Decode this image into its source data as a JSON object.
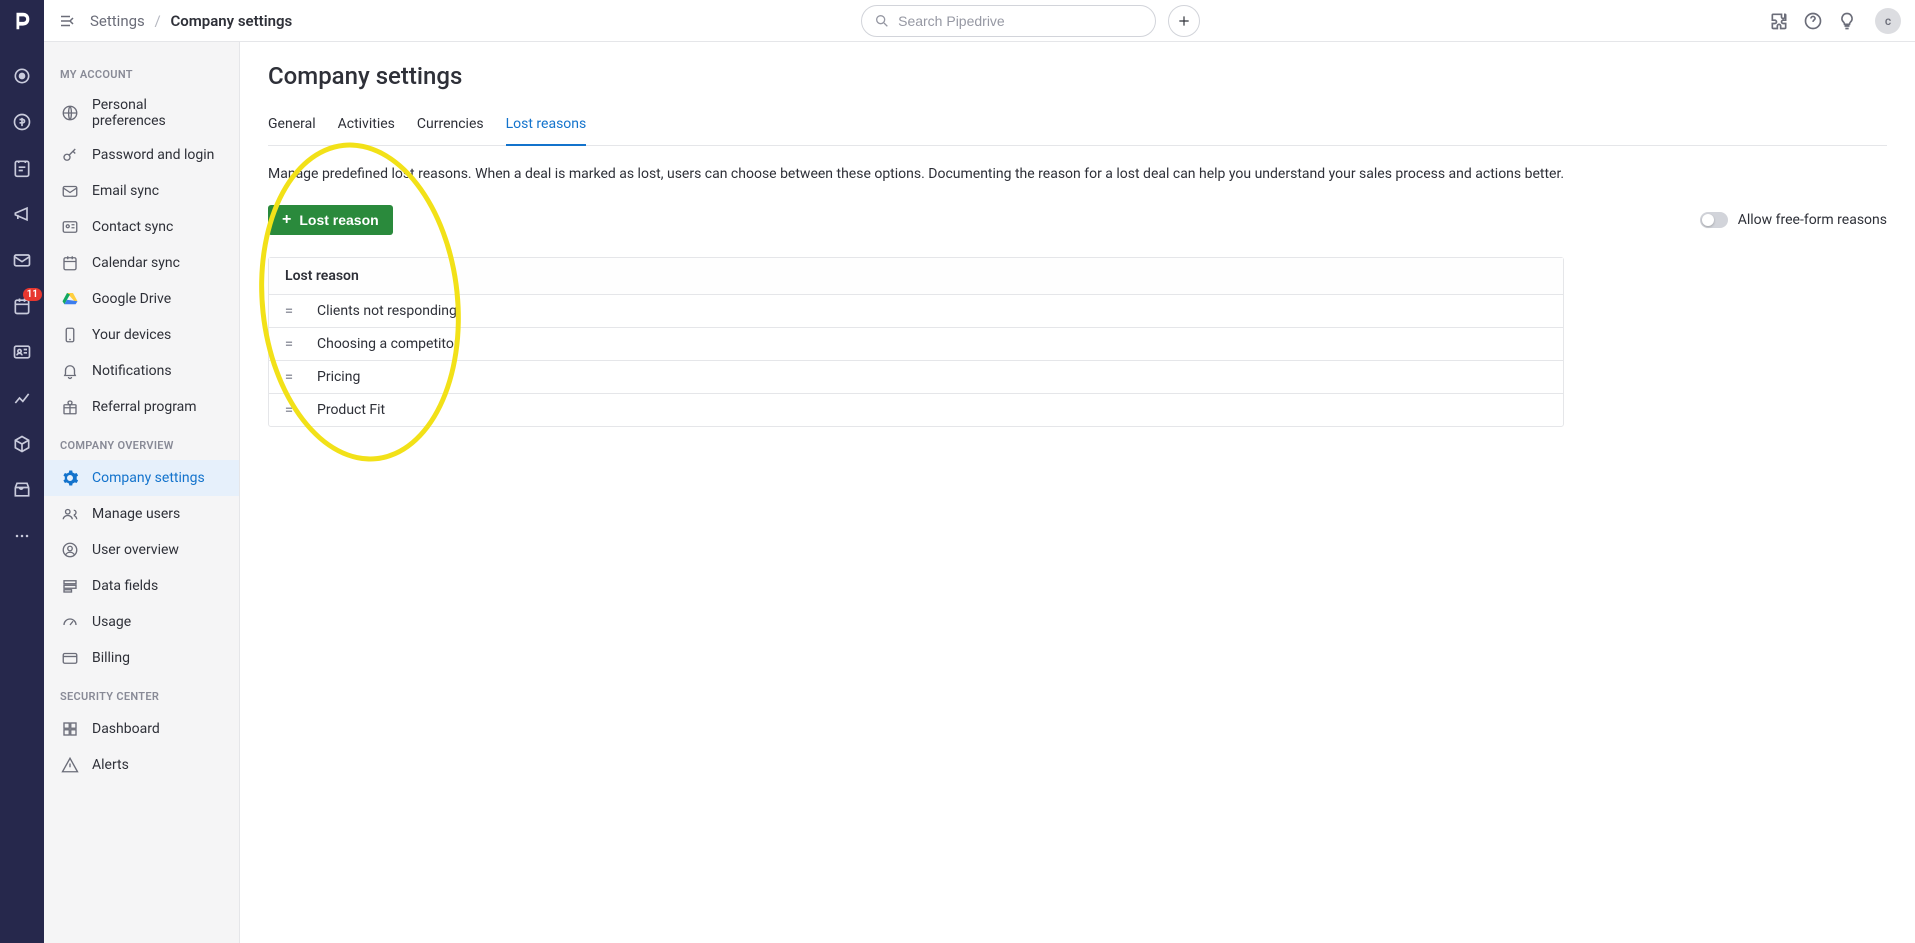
{
  "rail": {
    "badge": "11"
  },
  "topbar": {
    "breadcrumb_root": "Settings",
    "breadcrumb_current": "Company settings",
    "search_placeholder": "Search Pipedrive",
    "avatar_initial": "c"
  },
  "sidebar": {
    "sections": [
      {
        "title": "MY ACCOUNT",
        "items": [
          {
            "label": "Personal preferences",
            "icon": "globe"
          },
          {
            "label": "Password and login",
            "icon": "key"
          },
          {
            "label": "Email sync",
            "icon": "mail"
          },
          {
            "label": "Contact sync",
            "icon": "contact"
          },
          {
            "label": "Calendar sync",
            "icon": "calendar"
          },
          {
            "label": "Google Drive",
            "icon": "gdrive"
          },
          {
            "label": "Your devices",
            "icon": "device"
          },
          {
            "label": "Notifications",
            "icon": "bell"
          },
          {
            "label": "Referral program",
            "icon": "gift"
          }
        ]
      },
      {
        "title": "COMPANY OVERVIEW",
        "items": [
          {
            "label": "Company settings",
            "icon": "gear",
            "active": true
          },
          {
            "label": "Manage users",
            "icon": "users"
          },
          {
            "label": "User overview",
            "icon": "user-circle"
          },
          {
            "label": "Data fields",
            "icon": "fields"
          },
          {
            "label": "Usage",
            "icon": "gauge"
          },
          {
            "label": "Billing",
            "icon": "card"
          }
        ]
      },
      {
        "title": "SECURITY CENTER",
        "items": [
          {
            "label": "Dashboard",
            "icon": "grid"
          },
          {
            "label": "Alerts",
            "icon": "alert"
          }
        ]
      }
    ]
  },
  "page": {
    "title": "Company settings",
    "tabs": [
      "General",
      "Activities",
      "Currencies",
      "Lost reasons"
    ],
    "active_tab_index": 3,
    "description": "Manage predefined lost reasons. When a deal is marked as lost, users can choose between these options. Documenting the reason for a lost deal can help you understand your sales process and actions better.",
    "add_button": "Lost reason",
    "toggle_label": "Allow free-form reasons",
    "table_header": "Lost reason",
    "rows": [
      "Clients not responding",
      "Choosing a competitor",
      "Pricing",
      "Product Fit"
    ]
  }
}
